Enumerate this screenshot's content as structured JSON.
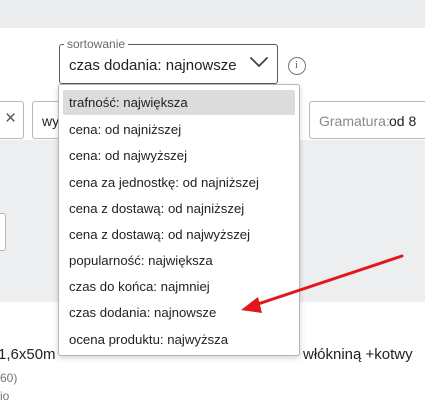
{
  "sort": {
    "legend": "sortowanie",
    "selected": "czas dodania: najnowsze",
    "options": [
      "trafność: największa",
      "cena: od najniższej",
      "cena: od najwyższej",
      "cena za jednostkę: od najniższej",
      "cena z dostawą: od najniższej",
      "cena z dostawą: od najwyższej",
      "popularność: największa",
      "czas do końca: najmniej",
      "czas dodania: najnowsze",
      "ocena produktu: najwyższa"
    ],
    "highlighted_index": 0
  },
  "filters": {
    "clear_icon": "×",
    "wy_text": "wy",
    "gramatura_label": "Gramatura:",
    "gramatura_value": "od 8"
  },
  "product": {
    "title": "1,6x50m",
    "title_tail": "włókniną +kotwy",
    "sub1": "60)",
    "sub2": "io"
  },
  "info_icon_glyph": "i",
  "colors": {
    "arrow": "#e3171b",
    "highlight": "#dcdcdc"
  }
}
